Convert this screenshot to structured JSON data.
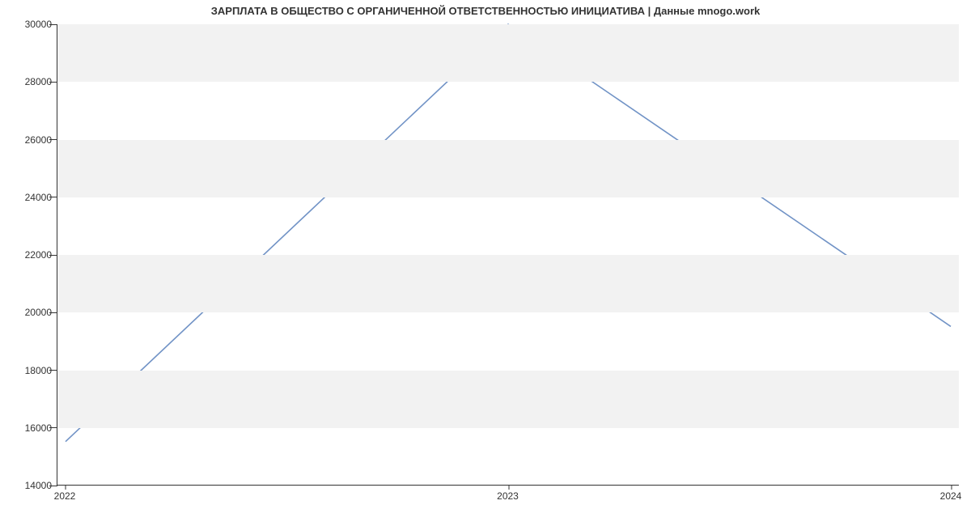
{
  "chart_data": {
    "type": "line",
    "title": "ЗАРПЛАТА В ОБЩЕСТВО С ОРГАНИЧЕННОЙ ОТВЕТСТВЕННОСТЬЮ ИНИЦИАТИВА | Данные mnogo.work",
    "x": [
      2022,
      2023,
      2024
    ],
    "values": [
      15500,
      30000,
      19500
    ],
    "x_ticks": [
      2022,
      2023,
      2024
    ],
    "y_ticks": [
      14000,
      16000,
      18000,
      20000,
      22000,
      24000,
      26000,
      28000,
      30000
    ],
    "xlim": [
      2022,
      2024
    ],
    "ylim": [
      14000,
      30000
    ],
    "xlabel": "",
    "ylabel": "",
    "line_color": "#7193c6"
  }
}
